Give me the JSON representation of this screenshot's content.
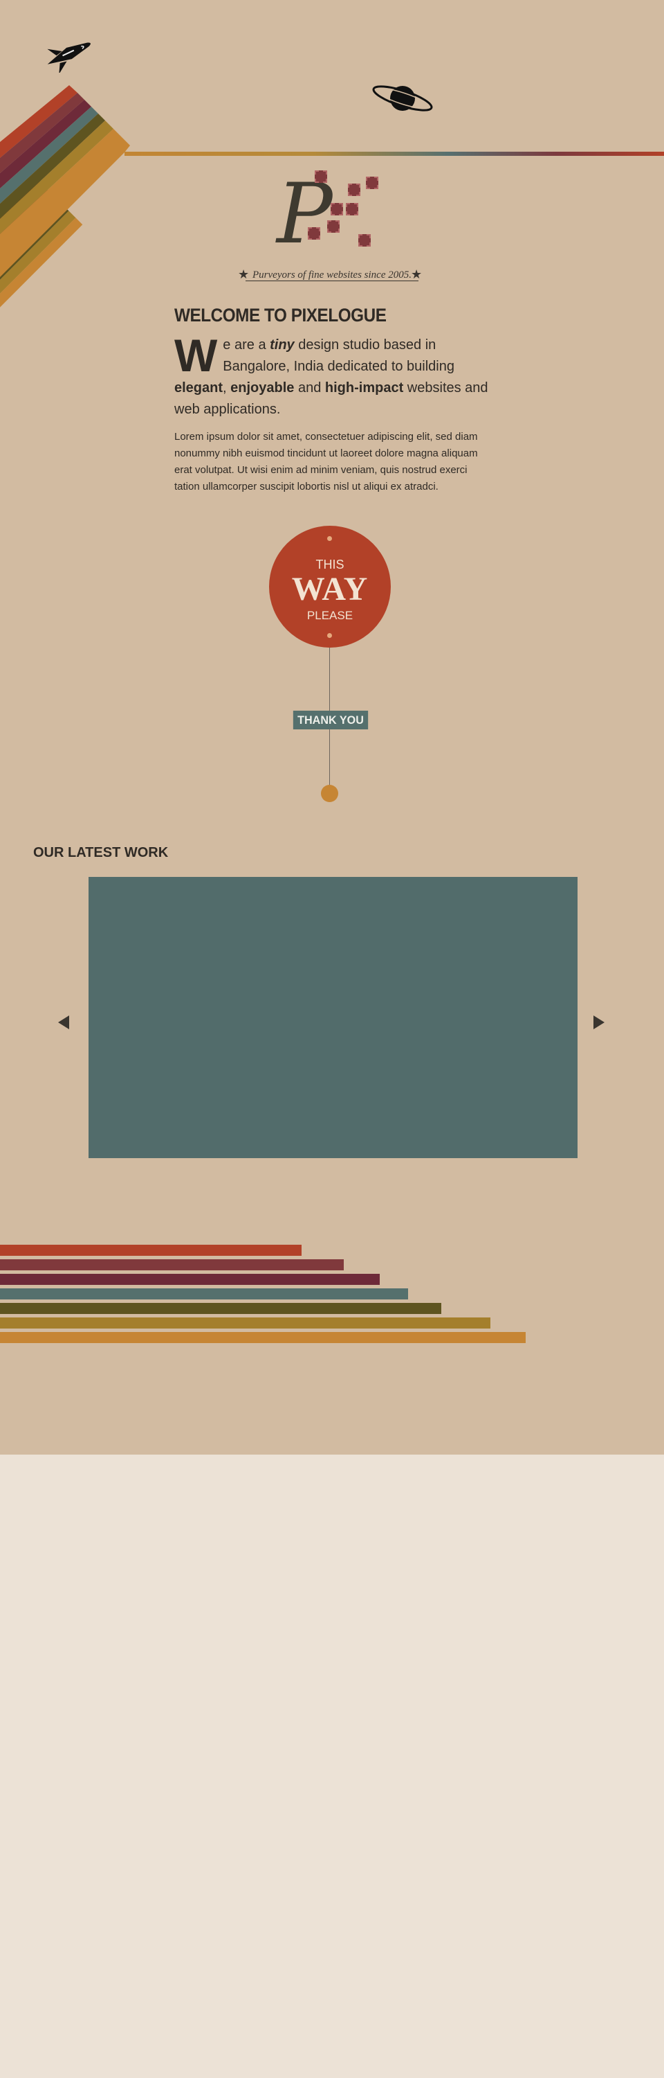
{
  "header": {
    "logo_text": "P",
    "tagline": "Purveyors of fine websites since 2005.",
    "star": "★"
  },
  "welcome": {
    "title": "WELCOME TO PIXELOGUE",
    "dropcap": "W",
    "lead_1": "e are a ",
    "lead_tiny": "tiny",
    "lead_2": " design studio based in Bangalore, India dedicated to building ",
    "lead_elegant": "elegant",
    "lead_comma": ", ",
    "lead_enjoyable": "enjoyable",
    "lead_and": " and ",
    "lead_impact": "high-impact",
    "lead_3": " websites and web applications.",
    "body": "Lorem ipsum dolor sit amet, consectetuer adipiscing elit, sed diam nonummy nibh euismod tincidunt ut laoreet dolore magna aliquam erat volutpat. Ut wisi enim ad minim veniam, quis nostrud exerci tation ullamcorper suscipit lobortis nisl ut aliqui ex atradci."
  },
  "cta": {
    "this": "THIS",
    "way": "WAY",
    "please": "PLEASE",
    "thanks": "THANK YOU"
  },
  "work": {
    "heading": "OUR LATEST WORK"
  },
  "colors": {
    "stripe_red": "#b24128",
    "stripe_maroon": "#80393c",
    "stripe_wine": "#6e2a39",
    "stripe_teal": "#55706d",
    "stripe_olive": "#5e5420",
    "stripe_mustard": "#a47f2c",
    "stripe_orange": "#c68534"
  }
}
